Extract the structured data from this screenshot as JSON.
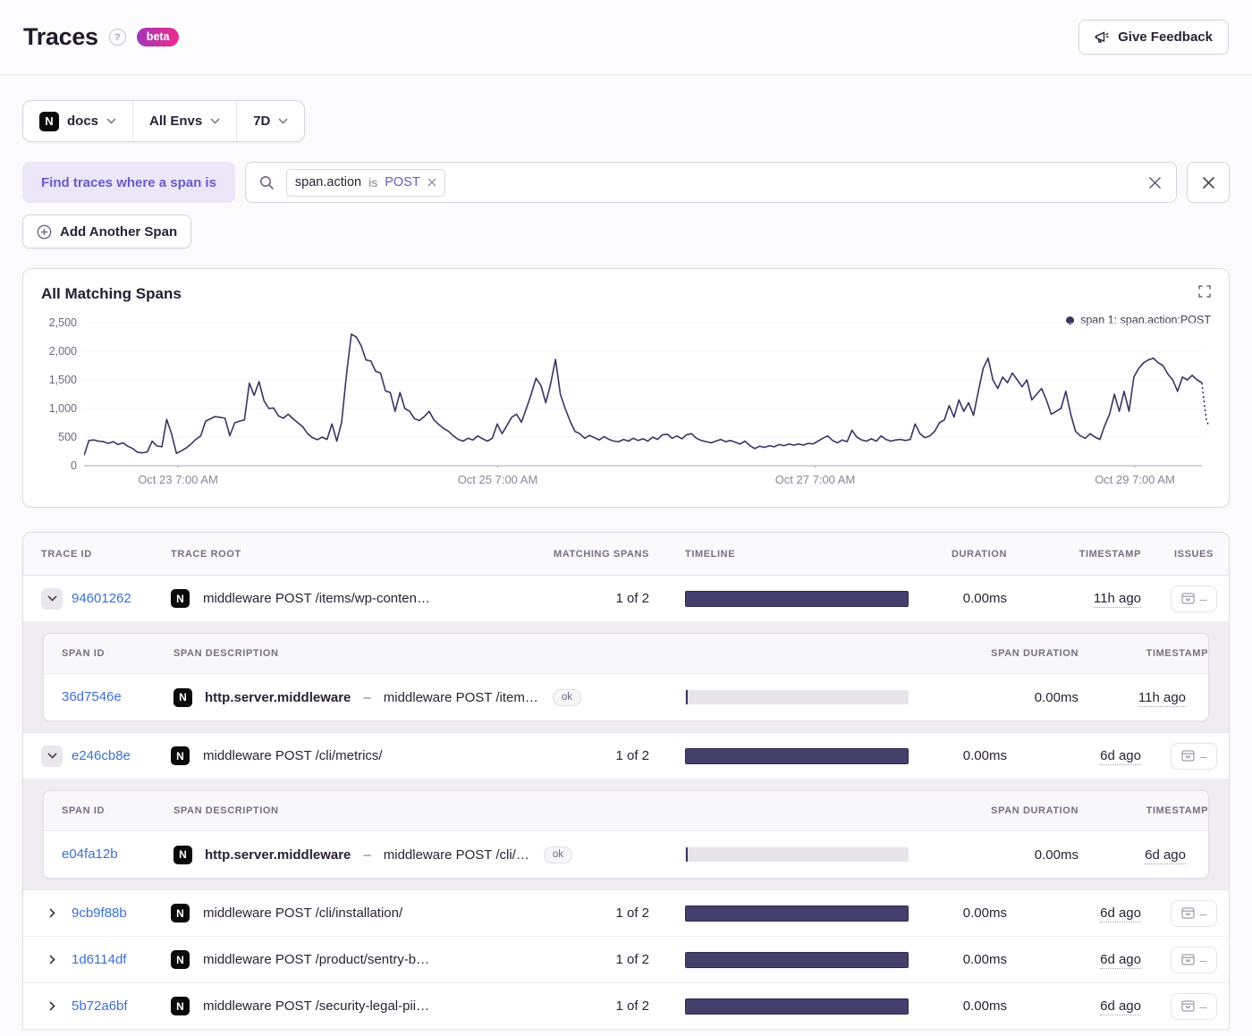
{
  "header": {
    "title": "Traces",
    "beta_label": "beta",
    "feedback_label": "Give Feedback"
  },
  "filters": {
    "project": "docs",
    "environment": "All Envs",
    "period": "7D"
  },
  "query": {
    "find_label": "Find traces where a span is",
    "token": {
      "key": "span.action",
      "op": "is",
      "value": "POST"
    },
    "add_span_label": "Add Another Span"
  },
  "misc": {
    "dash": "–",
    "issues_dash": "–"
  },
  "colors": {
    "accent_purple": "#6a5bc6",
    "chart_line": "#3a3463",
    "timeline_bar": "#443f6b",
    "link_blue": "#3c6fd6",
    "badge_gradient_from": "#a136b9",
    "badge_gradient_to": "#ee2b8c"
  },
  "chart_data": {
    "type": "line",
    "title": "All Matching Spans",
    "xlabel": "",
    "ylabel": "",
    "ylim": [
      0,
      2500
    ],
    "grid": true,
    "legend_position": "top-right",
    "y_ticks": [
      "0",
      "500",
      "1,000",
      "1,500",
      "2,000",
      "2,500"
    ],
    "y_tick_values": [
      0,
      500,
      1000,
      1500,
      2000,
      2500
    ],
    "x_ticks": [
      "Oct 23 7:00 AM",
      "Oct 25 7:00 AM",
      "Oct 27 7:00 AM",
      "Oct 29 7:00 AM"
    ],
    "x_tick_fractions": [
      0.084,
      0.37,
      0.654,
      0.94
    ],
    "series": [
      {
        "name": "span 1: span.action:POST",
        "values": [
          180,
          440,
          450,
          430,
          420,
          390,
          420,
          370,
          400,
          340,
          300,
          235,
          225,
          240,
          430,
          345,
          330,
          810,
          560,
          215,
          260,
          310,
          380,
          460,
          520,
          780,
          820,
          860,
          845,
          830,
          525,
          750,
          780,
          800,
          1440,
          1230,
          1470,
          1140,
          1000,
          1010,
          870,
          830,
          900,
          820,
          750,
          680,
          560,
          490,
          455,
          500,
          460,
          730,
          430,
          760,
          1600,
          2300,
          2250,
          2100,
          1850,
          1830,
          1650,
          1620,
          1310,
          1280,
          950,
          1280,
          1000,
          950,
          820,
          790,
          860,
          950,
          800,
          720,
          650,
          600,
          520,
          460,
          430,
          480,
          450,
          520,
          470,
          430,
          480,
          730,
          560,
          700,
          850,
          900,
          760,
          1000,
          1250,
          1530,
          1400,
          1100,
          1430,
          1860,
          1250,
          1000,
          780,
          600,
          560,
          480,
          530,
          490,
          450,
          510,
          460,
          430,
          420,
          460,
          430,
          480,
          440,
          470,
          430,
          500,
          460,
          540,
          550,
          480,
          520,
          470,
          540,
          560,
          480,
          440,
          420,
          400,
          430,
          460,
          420,
          440,
          410,
          380,
          430,
          350,
          300,
          340,
          320,
          350,
          330,
          370,
          350,
          380,
          360,
          380,
          360,
          390,
          380,
          430,
          480,
          520,
          440,
          400,
          450,
          420,
          620,
          500,
          450,
          430,
          470,
          430,
          520,
          460,
          430,
          450,
          460,
          440,
          460,
          730,
          560,
          490,
          520,
          600,
          750,
          800,
          1050,
          850,
          1150,
          950,
          1100,
          880,
          1300,
          1700,
          1880,
          1500,
          1350,
          1550,
          1450,
          1620,
          1500,
          1380,
          1500,
          1150,
          1250,
          1350,
          1150,
          900,
          950,
          1000,
          1300,
          900,
          600,
          520,
          480,
          560,
          500,
          460,
          700,
          900,
          1250,
          950,
          1300,
          950,
          1550,
          1700,
          1800,
          1850,
          1880,
          1800,
          1750,
          1600,
          1500,
          1300,
          1550,
          1500,
          1580,
          1500,
          1450
        ],
        "dashed_tail": [
          1100,
          800,
          700
        ]
      }
    ]
  },
  "table": {
    "columns": [
      "TRACE ID",
      "TRACE ROOT",
      "MATCHING SPANS",
      "TIMELINE",
      "DURATION",
      "TIMESTAMP",
      "ISSUES"
    ],
    "span_columns": [
      "SPAN ID",
      "SPAN DESCRIPTION",
      "SPAN DURATION",
      "TIMESTAMP"
    ],
    "rows": [
      {
        "trace_id": "94601262",
        "root": "middleware POST /items/wp-conten…",
        "matching": "1 of 2",
        "duration": "0.00ms",
        "timestamp": "11h ago",
        "spans": [
          {
            "span_id": "36d7546e",
            "op": "http.server.middleware",
            "desc": "middleware POST /item…",
            "status": "ok",
            "duration": "0.00ms",
            "timestamp": "11h ago"
          }
        ]
      },
      {
        "trace_id": "e246cb8e",
        "root": "middleware POST /cli/metrics/",
        "matching": "1 of 2",
        "duration": "0.00ms",
        "timestamp": "6d ago",
        "spans": [
          {
            "span_id": "e04fa12b",
            "op": "http.server.middleware",
            "desc": "middleware POST /cli/…",
            "status": "ok",
            "duration": "0.00ms",
            "timestamp": "6d ago"
          }
        ]
      },
      {
        "trace_id": "9cb9f88b",
        "root": "middleware POST /cli/installation/",
        "matching": "1 of 2",
        "duration": "0.00ms",
        "timestamp": "6d ago"
      },
      {
        "trace_id": "1d6114df",
        "root": "middleware POST /product/sentry-b…",
        "matching": "1 of 2",
        "duration": "0.00ms",
        "timestamp": "6d ago"
      },
      {
        "trace_id": "5b72a6bf",
        "root": "middleware POST /security-legal-pii…",
        "matching": "1 of 2",
        "duration": "0.00ms",
        "timestamp": "6d ago"
      }
    ]
  }
}
